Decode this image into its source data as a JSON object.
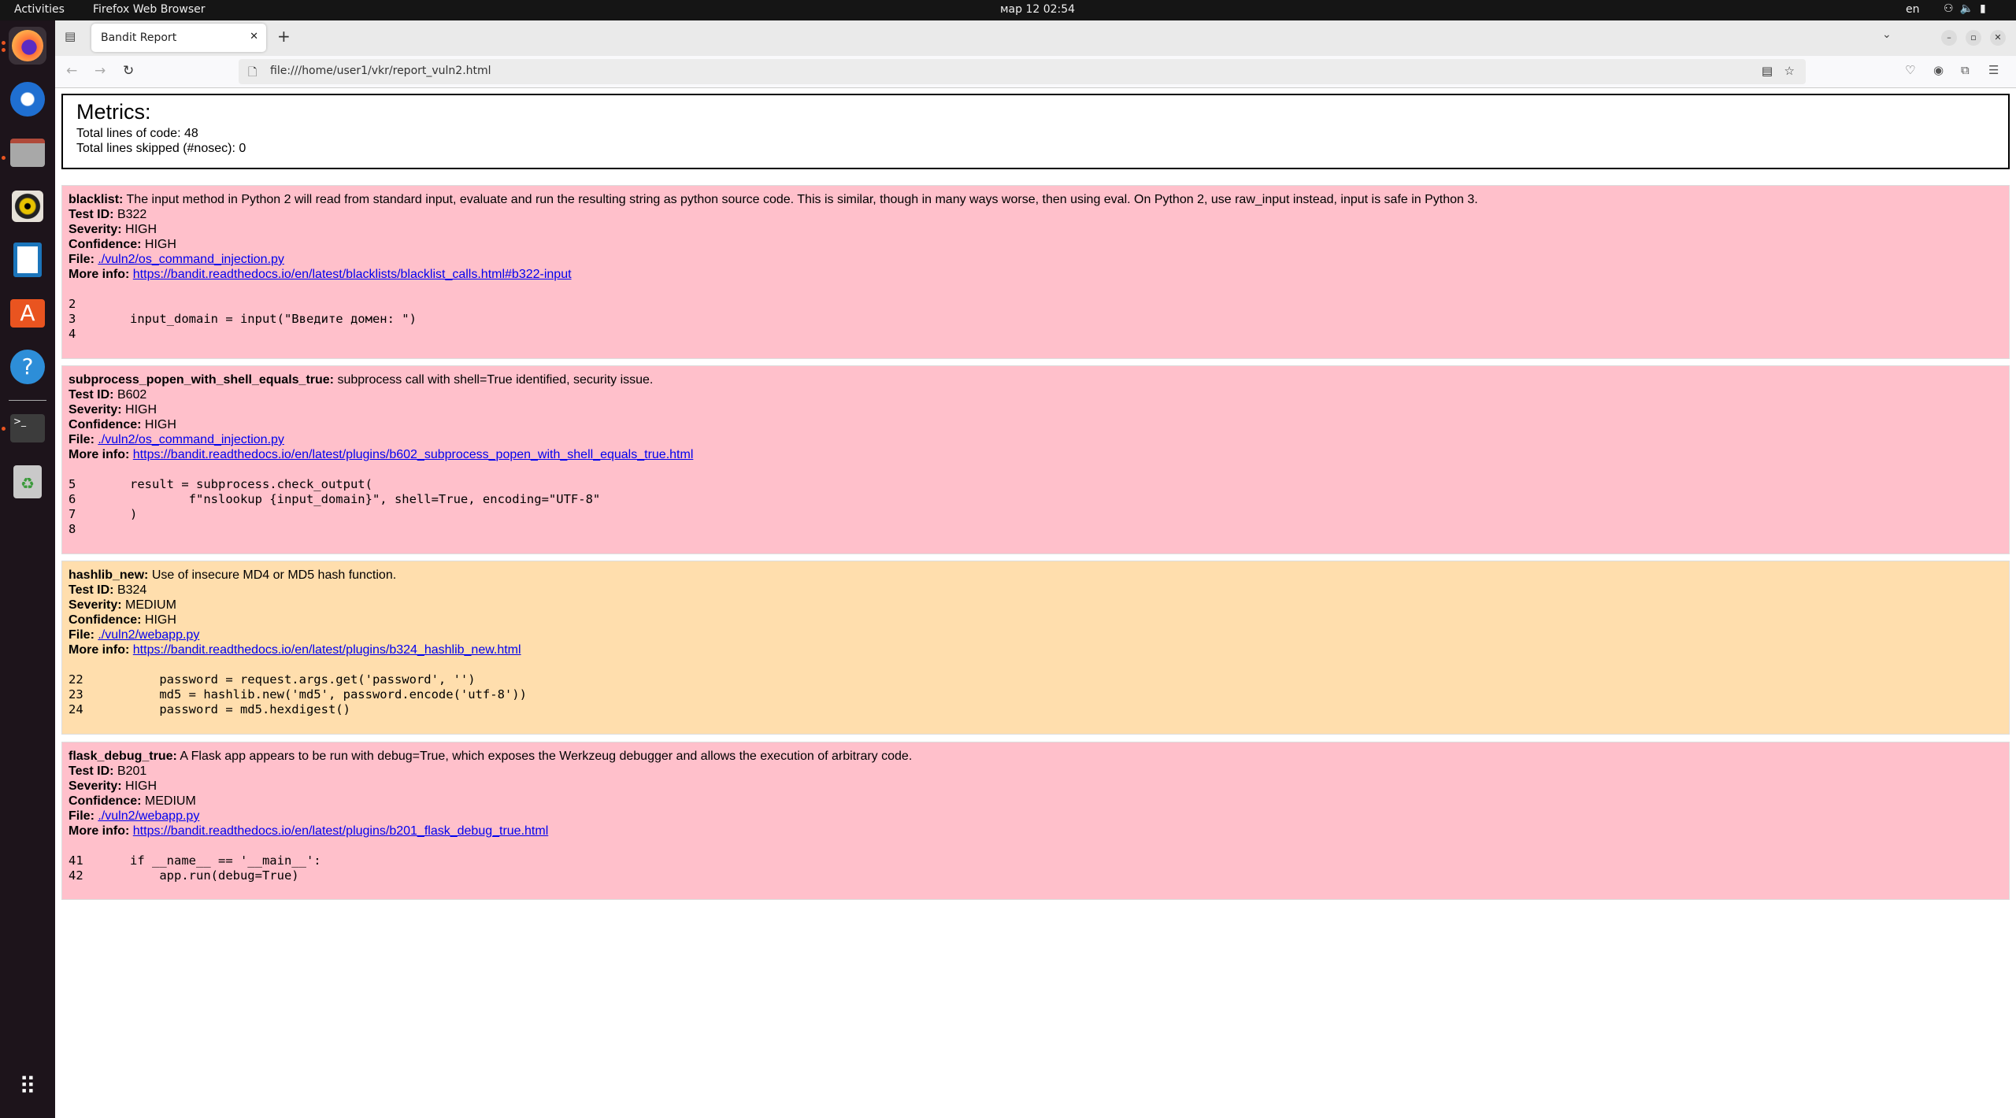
{
  "topbar": {
    "activities": "Activities",
    "app": "Firefox Web Browser",
    "clock": "мар 12  02:54",
    "lang": "en"
  },
  "dock": [
    "firefox-icon",
    "thunderbird-icon",
    "files-icon",
    "rhythmbox-icon",
    "writer-icon",
    "app-center-icon",
    "help-icon",
    "terminal-icon",
    "trash-icon"
  ],
  "browser": {
    "tab_title": "Bandit Report",
    "url": "file:///home/user1/vkr/report_vuln2.html"
  },
  "metrics": {
    "title": "Metrics:",
    "loc": "Total lines of code: 48",
    "skipped": "Total lines skipped (#nosec): 0"
  },
  "labels": {
    "test_id": "Test ID:",
    "severity": "Severity:",
    "confidence": "Confidence:",
    "file": "File:",
    "more": "More info:"
  },
  "colors": {
    "high": "#FFC0CB",
    "medium": "#FFDEAD"
  },
  "issues": [
    {
      "name": "blacklist:",
      "desc": "The input method in Python 2 will read from standard input, evaluate and run the resulting string as python source code. This is similar, though in many ways worse, then using eval. On Python 2, use raw_input instead, input is safe in Python 3.",
      "test_id": "B322",
      "severity": "HIGH",
      "confidence": "HIGH",
      "file": "./vuln2/os_command_injection.py",
      "more": "https://bandit.readthedocs.io/en/latest/blacklists/blacklist_calls.html#b322-input",
      "code": [
        {
          "n": "2",
          "c": ""
        },
        {
          "n": "3",
          "c": "input_domain = input(\"Введите домен: \")"
        },
        {
          "n": "4",
          "c": ""
        }
      ]
    },
    {
      "name": "subprocess_popen_with_shell_equals_true:",
      "desc": "subprocess call with shell=True identified, security issue.",
      "test_id": "B602",
      "severity": "HIGH",
      "confidence": "HIGH",
      "file": "./vuln2/os_command_injection.py",
      "more": "https://bandit.readthedocs.io/en/latest/plugins/b602_subprocess_popen_with_shell_equals_true.html",
      "code": [
        {
          "n": "5",
          "c": "result = subprocess.check_output("
        },
        {
          "n": "6",
          "c": "        f\"nslookup {input_domain}\", shell=True, encoding=\"UTF-8\""
        },
        {
          "n": "7",
          "c": ")"
        },
        {
          "n": "8",
          "c": ""
        }
      ]
    },
    {
      "name": "hashlib_new:",
      "desc": "Use of insecure MD4 or MD5 hash function.",
      "test_id": "B324",
      "severity": "MEDIUM",
      "confidence": "HIGH",
      "file": "./vuln2/webapp.py",
      "more": "https://bandit.readthedocs.io/en/latest/plugins/b324_hashlib_new.html",
      "code": [
        {
          "n": "22",
          "c": "    password = request.args.get('password', '')"
        },
        {
          "n": "23",
          "c": "    md5 = hashlib.new('md5', password.encode('utf-8'))"
        },
        {
          "n": "24",
          "c": "    password = md5.hexdigest()"
        }
      ]
    },
    {
      "name": "flask_debug_true:",
      "desc": "A Flask app appears to be run with debug=True, which exposes the Werkzeug debugger and allows the execution of arbitrary code.",
      "test_id": "B201",
      "severity": "HIGH",
      "confidence": "MEDIUM",
      "file": "./vuln2/webapp.py",
      "more": "https://bandit.readthedocs.io/en/latest/plugins/b201_flask_debug_true.html",
      "code": [
        {
          "n": "41",
          "c": "if __name__ == '__main__':"
        },
        {
          "n": "42",
          "c": "    app.run(debug=True)"
        }
      ]
    }
  ]
}
